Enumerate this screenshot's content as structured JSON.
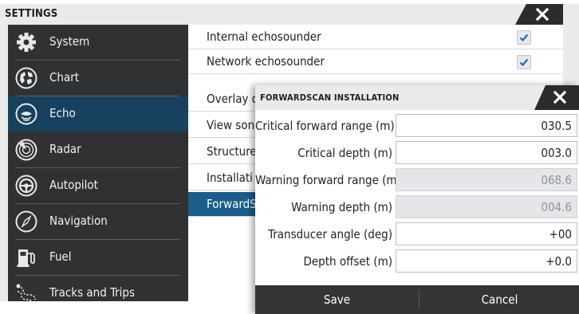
{
  "window": {
    "title": "SETTINGS"
  },
  "sidebar": {
    "items": [
      {
        "label": "System",
        "icon": "gear-icon"
      },
      {
        "label": "Chart",
        "icon": "chart-icon"
      },
      {
        "label": "Echo",
        "icon": "echo-icon",
        "active": true
      },
      {
        "label": "Radar",
        "icon": "radar-icon"
      },
      {
        "label": "Autopilot",
        "icon": "steering-wheel-icon"
      },
      {
        "label": "Navigation",
        "icon": "compass-icon"
      },
      {
        "label": "Fuel",
        "icon": "fuel-pump-icon"
      },
      {
        "label": "Tracks and Trips",
        "icon": "tracks-icon"
      }
    ]
  },
  "content": {
    "items": [
      {
        "label": "Internal echosounder",
        "checked": true
      },
      {
        "label": "Network echosounder",
        "checked": true
      },
      {
        "label": "Overlay d"
      },
      {
        "label": "View son"
      },
      {
        "label": "Structure"
      },
      {
        "label": "Installati"
      },
      {
        "label": "ForwardS",
        "active": true
      }
    ]
  },
  "dialog": {
    "title": "FORWARDSCAN INSTALLATION",
    "fields": [
      {
        "label": "Critical forward range (m)",
        "value": "030.5",
        "enabled": true
      },
      {
        "label": "Critical depth (m)",
        "value": "003.0",
        "enabled": true
      },
      {
        "label": "Warning forward range (m)",
        "value": "068.6",
        "enabled": false
      },
      {
        "label": "Warning depth (m)",
        "value": "004.6",
        "enabled": false
      },
      {
        "label": "Transducer angle (deg)",
        "value": "+00",
        "enabled": true
      },
      {
        "label": "Depth offset (m)",
        "value": "+0.0",
        "enabled": true
      }
    ],
    "save_label": "Save",
    "cancel_label": "Cancel"
  },
  "colors": {
    "sidebar_bg": "#303133",
    "sidebar_active": "#17415e",
    "content_active": "#1a5d8a",
    "dialog_buttons_bg": "#323436"
  }
}
